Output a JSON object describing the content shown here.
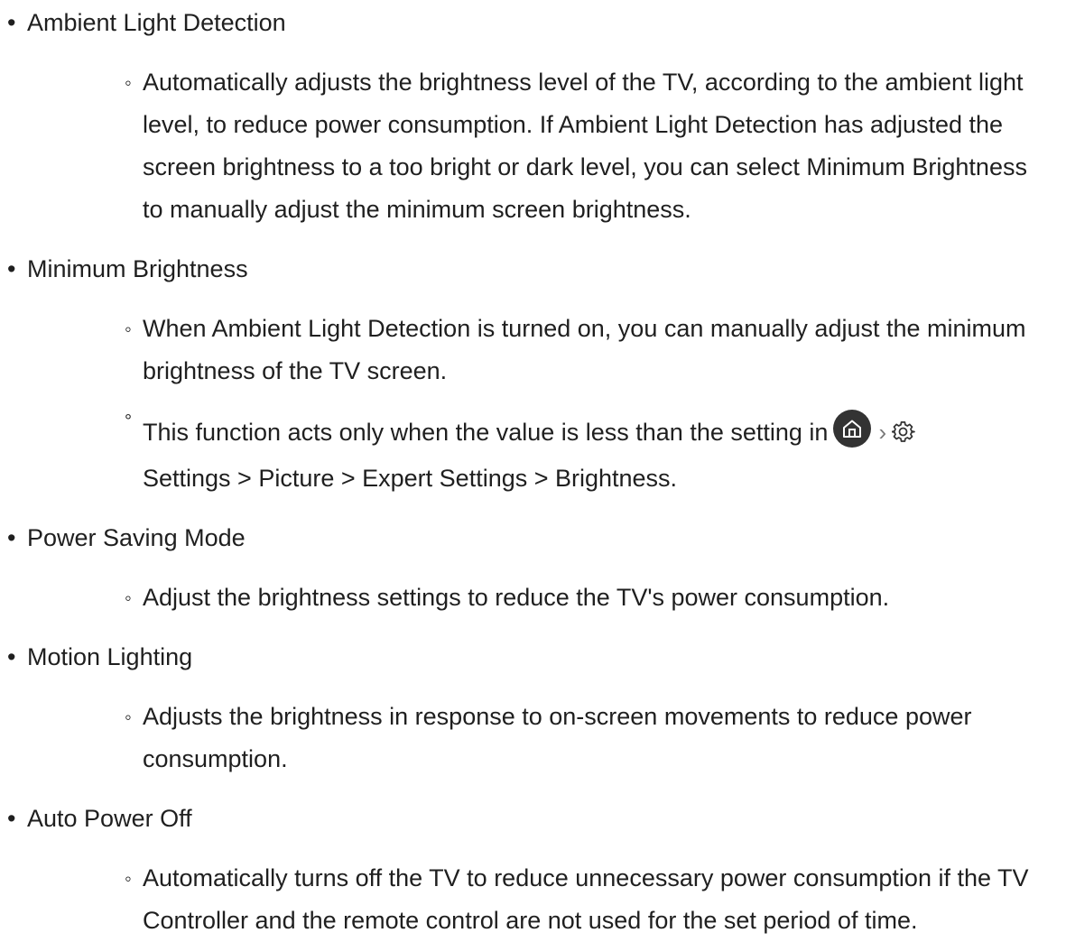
{
  "items": [
    {
      "title": "Ambient Light Detection",
      "descriptions": [
        "Automatically adjusts the brightness level of the TV, according to the ambient light level, to reduce power consumption. If Ambient Light Detection has adjusted the screen brightness to a too bright or dark level, you can select Minimum Brightness to manually adjust the minimum screen brightness."
      ]
    },
    {
      "title": "Minimum Brightness",
      "descriptions": [
        "When Ambient Light Detection is turned on, you can manually adjust the minimum brightness of the TV screen."
      ],
      "note": {
        "prefix": "This function acts only when the value is less than the setting in",
        "path": "Settings > Picture > Expert Settings > Brightness."
      }
    },
    {
      "title": "Power Saving Mode",
      "descriptions": [
        "Adjust the brightness settings to reduce the TV's power consumption."
      ]
    },
    {
      "title": "Motion Lighting",
      "descriptions": [
        "Adjusts the brightness in response to on-screen movements to reduce power consumption."
      ]
    },
    {
      "title": "Auto Power Off",
      "descriptions": [
        "Automatically turns off the TV to reduce unnecessary power consumption if the TV Controller and the remote control are not used for the set period of time."
      ]
    }
  ],
  "icons": {
    "home": "home-icon",
    "chevron": "chevron-right-icon",
    "gear": "gear-icon"
  },
  "colors": {
    "text": "#1f1f1f",
    "home_icon_bg": "#333333"
  }
}
